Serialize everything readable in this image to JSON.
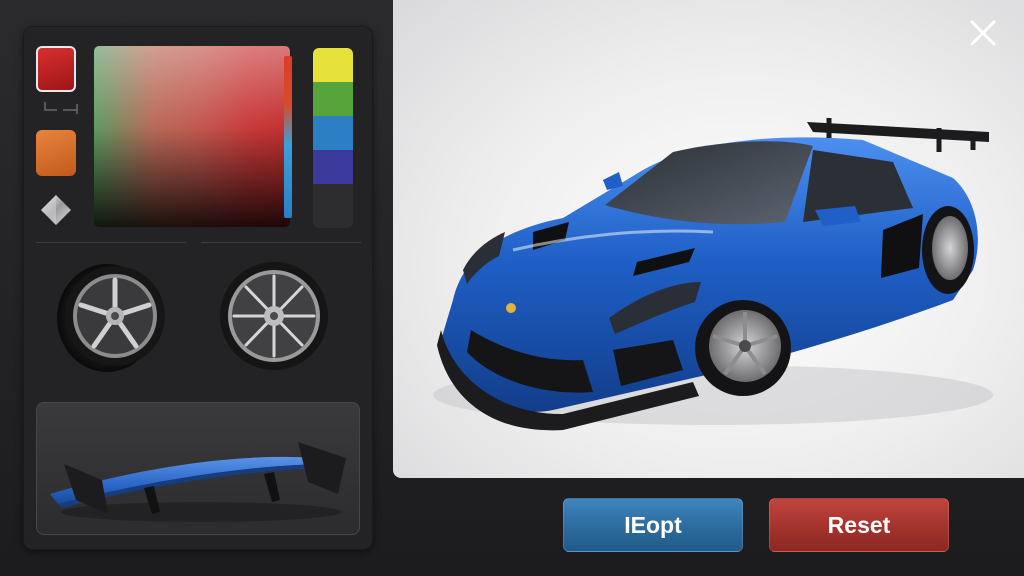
{
  "colors": {
    "panel_bg": "#232325",
    "red_swatch": "#c22424",
    "orange_swatch": "#d8702f",
    "car_body": "#1f5fc6",
    "apply_button": "#2c6b9e",
    "reset_button": "#a3332d"
  },
  "swatches": [
    {
      "name": "red",
      "selected": true
    },
    {
      "name": "orange",
      "selected": false
    },
    {
      "name": "metallic-silver",
      "selected": false
    }
  ],
  "hue_strip": [
    "#e7e23a",
    "#56a43a",
    "#2b7fc2",
    "#3a3a9a",
    "#2d2d30"
  ],
  "wheels": [
    "split-spoke-wheel",
    "multi-spoke-wheel"
  ],
  "spoiler": {
    "icon": "rear-wing-spoiler",
    "color": "#2a66c8"
  },
  "preview": {
    "subject": "blue-sports-car"
  },
  "actions": {
    "apply_label": "IEopt",
    "reset_label": "Reset"
  },
  "icons": {
    "close": "close-icon"
  }
}
